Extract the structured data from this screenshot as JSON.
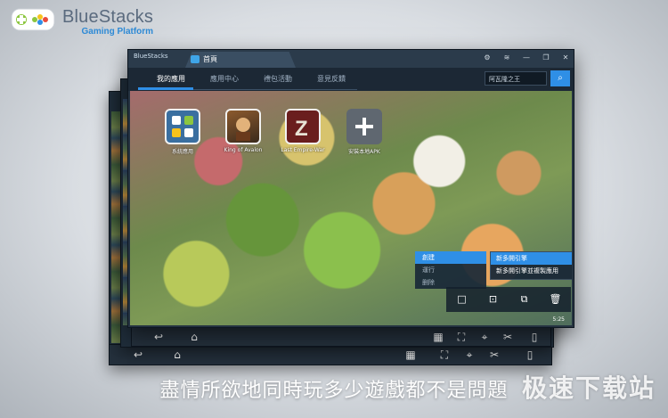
{
  "brand": {
    "name": "BlueStacks",
    "subtitle": "Gaming Platform"
  },
  "window": {
    "small_logo": "BlueStacks",
    "tab_label": "首頁",
    "nav_tabs": [
      "我的應用",
      "應用中心",
      "禮包活動",
      "意見反饋"
    ],
    "search_placeholder": "阿瓦隆之王",
    "apps": [
      {
        "label": "系統應用",
        "icon": "settings-grid-icon"
      },
      {
        "label": "King of Avalon",
        "icon": "king-of-avalon-icon"
      },
      {
        "label": "Last Empire-War",
        "icon": "last-empire-war-icon"
      },
      {
        "label": "安裝本地APK",
        "icon": "plus-icon"
      }
    ],
    "context_menu": [
      "創建",
      "運行",
      "删除"
    ],
    "submenu": [
      "新多開引擎",
      "新多開引擎並複製應用"
    ],
    "time": "5:25"
  },
  "caption": "盡情所欲地同時玩多少遊戲都不是問題",
  "watermark": "极速下载站",
  "colors": {
    "accent": "#2f8fe6",
    "window": "#253341"
  }
}
